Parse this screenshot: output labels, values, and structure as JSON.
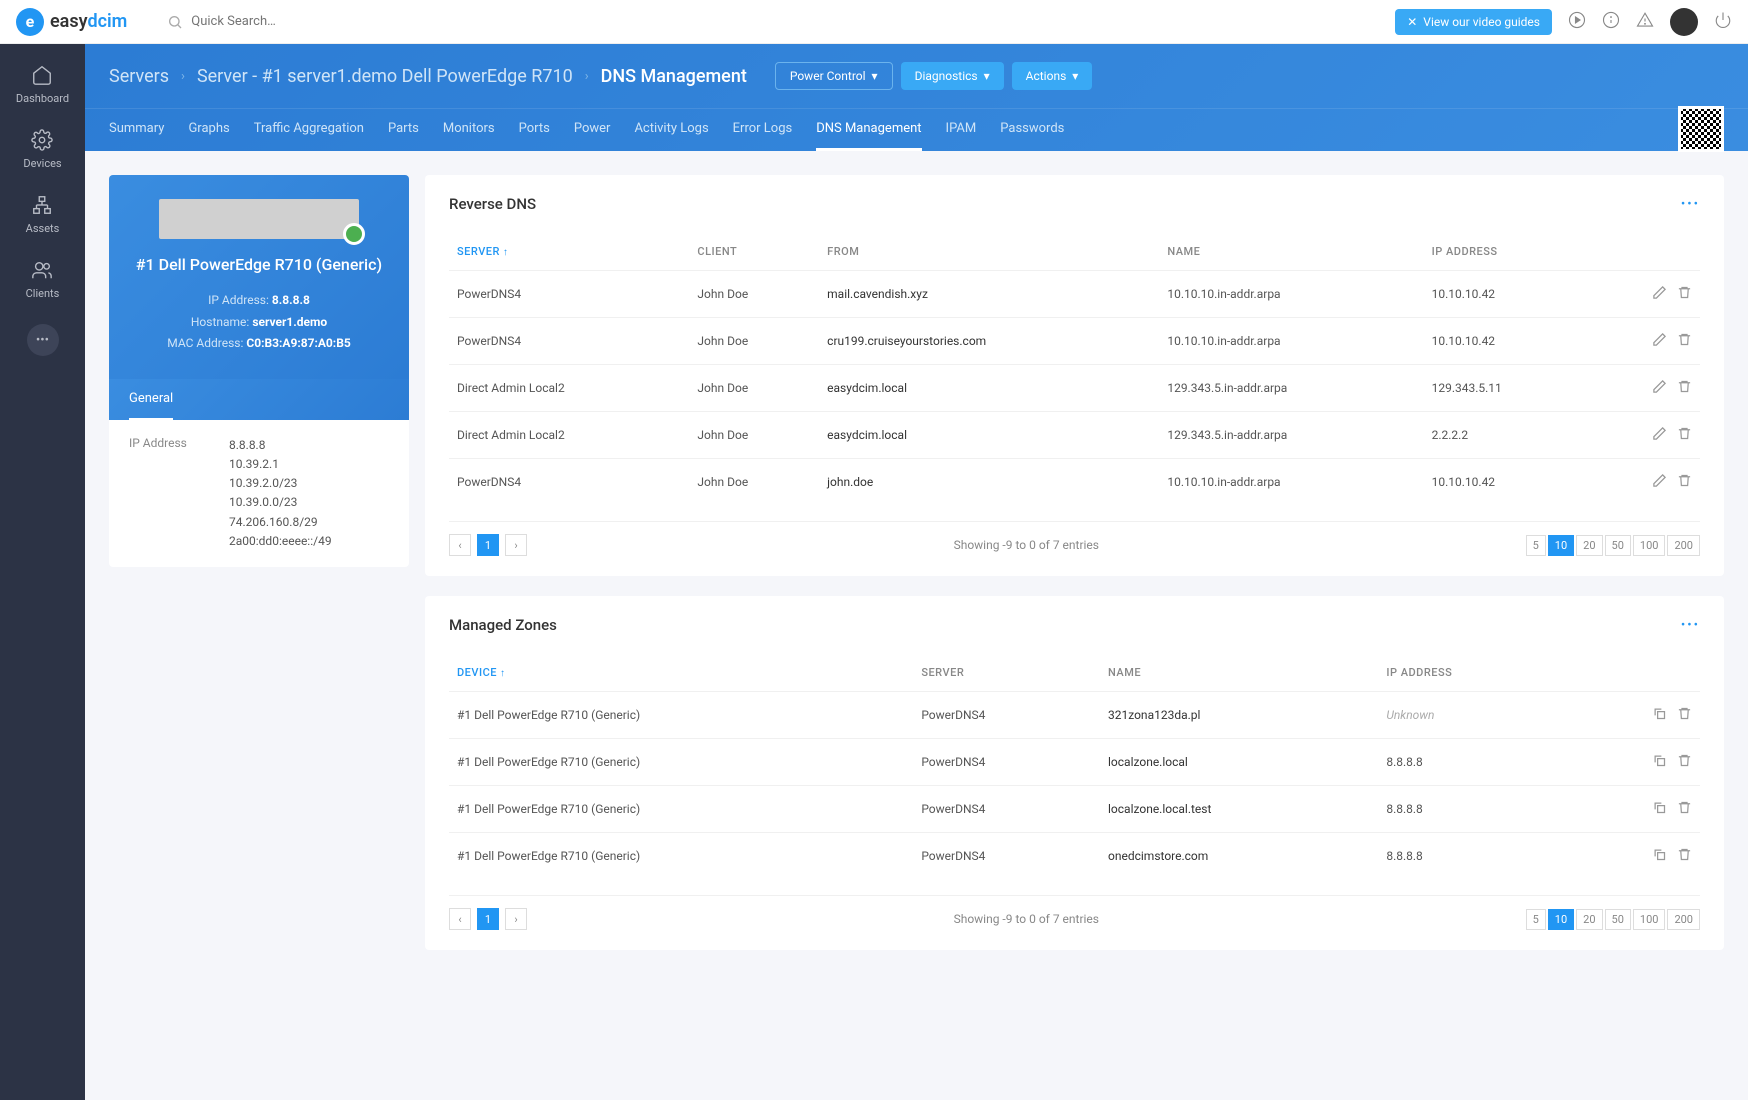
{
  "search_placeholder": "Quick Search…",
  "video_guide": "View our video guides",
  "sidebar": [
    {
      "label": "Dashboard"
    },
    {
      "label": "Devices"
    },
    {
      "label": "Assets"
    },
    {
      "label": "Clients"
    }
  ],
  "breadcrumb": {
    "servers": "Servers",
    "server": "Server - #1 server1.demo Dell PowerEdge R710",
    "page": "DNS Management"
  },
  "header_buttons": {
    "power": "Power Control",
    "diag": "Diagnostics",
    "actions": "Actions"
  },
  "tabs": [
    "Summary",
    "Graphs",
    "Traffic Aggregation",
    "Parts",
    "Monitors",
    "Ports",
    "Power",
    "Activity Logs",
    "Error Logs",
    "DNS Management",
    "IPAM",
    "Passwords"
  ],
  "active_tab": "DNS Management",
  "device": {
    "title": "#1 Dell PowerEdge R710 (Generic)",
    "ip_label": "IP Address:",
    "ip": "8.8.8.8",
    "host_label": "Hostname:",
    "host": "server1.demo",
    "mac_label": "MAC Address:",
    "mac": "C0:B3:A9:87:A0:B5",
    "tab": "General",
    "info_label": "IP Address",
    "ips": [
      "8.8.8.8",
      "10.39.2.1",
      "10.39.2.0/23",
      "10.39.0.0/23",
      "74.206.160.8/29",
      "2a00:dd0:eeee::/49"
    ]
  },
  "reverse": {
    "title": "Reverse DNS",
    "cols": [
      "SERVER",
      "CLIENT",
      "FROM",
      "NAME",
      "IP ADDRESS"
    ],
    "rows": [
      {
        "server": "PowerDNS4",
        "client": "John Doe",
        "from": "mail.cavendish.xyz",
        "name": "10.10.10.in-addr.arpa",
        "ip": "10.10.10.42"
      },
      {
        "server": "PowerDNS4",
        "client": "John Doe",
        "from": "cru199.cruiseyourstories.com",
        "name": "10.10.10.in-addr.arpa",
        "ip": "10.10.10.42"
      },
      {
        "server": "Direct Admin Local2",
        "client": "John Doe",
        "from": "easydcim.local",
        "name": "129.343.5.in-addr.arpa",
        "ip": "129.343.5.11"
      },
      {
        "server": "Direct Admin Local2",
        "client": "John Doe",
        "from": "easydcim.local",
        "name": "129.343.5.in-addr.arpa",
        "ip": "2.2.2.2"
      },
      {
        "server": "PowerDNS4",
        "client": "John Doe",
        "from": "john.doe",
        "name": "10.10.10.in-addr.arpa",
        "ip": "10.10.10.42"
      }
    ],
    "info": "Showing -9 to 0 of 7 entries"
  },
  "zones": {
    "title": "Managed Zones",
    "cols": [
      "DEVICE",
      "SERVER",
      "NAME",
      "IP ADDRESS"
    ],
    "rows": [
      {
        "device": "#1 Dell PowerEdge R710 (Generic)",
        "server": "PowerDNS4",
        "name": "321zona123da.pl",
        "ip": "Unknown",
        "unknown": true
      },
      {
        "device": "#1 Dell PowerEdge R710 (Generic)",
        "server": "PowerDNS4",
        "name": "localzone.local",
        "ip": "8.8.8.8"
      },
      {
        "device": "#1 Dell PowerEdge R710 (Generic)",
        "server": "PowerDNS4",
        "name": "localzone.local.test",
        "ip": "8.8.8.8"
      },
      {
        "device": "#1 Dell PowerEdge R710 (Generic)",
        "server": "PowerDNS4",
        "name": "onedcimstore.com",
        "ip": "8.8.8.8"
      }
    ],
    "info": "Showing -9 to 0 of 7 entries"
  },
  "page_sizes": [
    "5",
    "10",
    "20",
    "50",
    "100",
    "200"
  ],
  "page_active": "10",
  "page_num": "1"
}
